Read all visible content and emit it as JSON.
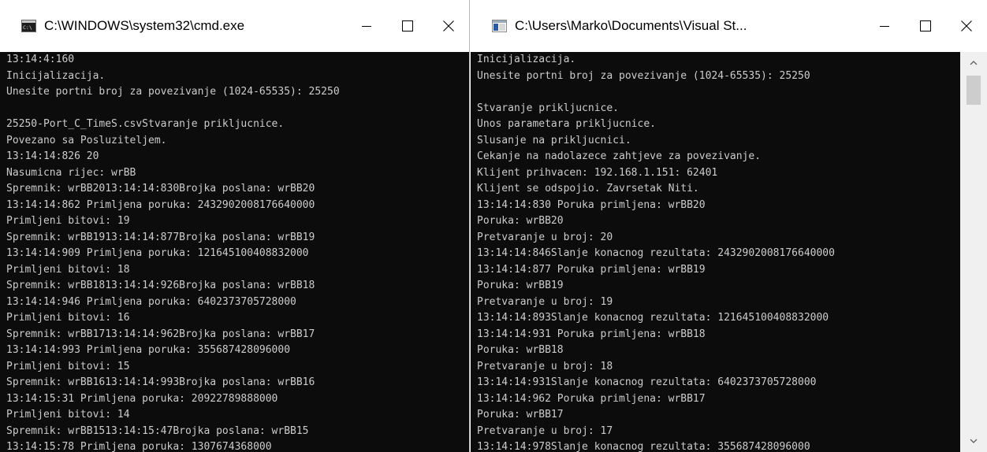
{
  "windows": [
    {
      "id": "left",
      "title": "C:\\WINDOWS\\system32\\cmd.exe",
      "lines": [
        "13:14:4:160",
        "Inicijalizacija.",
        "Unesite portni broj za povezivanje (1024-65535): 25250",
        "",
        "25250-Port_C_TimeS.csvStvaranje prikljucnice.",
        "Povezano sa Posluziteljem.",
        "13:14:14:826 20",
        "Nasumicna rijec: wrBB",
        "Spremnik: wrBB2013:14:14:830Brojka poslana: wrBB20",
        "13:14:14:862 Primljena poruka: 2432902008176640000",
        "Primljeni bitovi: 19",
        "Spremnik: wrBB1913:14:14:877Brojka poslana: wrBB19",
        "13:14:14:909 Primljena poruka: 121645100408832000",
        "Primljeni bitovi: 18",
        "Spremnik: wrBB1813:14:14:926Brojka poslana: wrBB18",
        "13:14:14:946 Primljena poruka: 6402373705728000",
        "Primljeni bitovi: 16",
        "Spremnik: wrBB1713:14:14:962Brojka poslana: wrBB17",
        "13:14:14:993 Primljena poruka: 355687428096000",
        "Primljeni bitovi: 15",
        "Spremnik: wrBB1613:14:14:993Brojka poslana: wrBB16",
        "13:14:15:31 Primljena poruka: 20922789888000",
        "Primljeni bitovi: 14",
        "Spremnik: wrBB1513:14:15:47Brojka poslana: wrBB15",
        "13:14:15:78 Primljena poruka: 1307674368000"
      ]
    },
    {
      "id": "right",
      "title": "C:\\Users\\Marko\\Documents\\Visual St...",
      "lines": [
        "Inicijalizacija.",
        "Unesite portni broj za povezivanje (1024-65535): 25250",
        "",
        "Stvaranje prikljucnice.",
        "Unos parametara prikljucnice.",
        "Slusanje na prikljucnici.",
        "Cekanje na nadolazece zahtjeve za povezivanje.",
        "Klijent prihvacen: 192.168.1.151: 62401",
        "Klijent se odspojio. Zavrsetak Niti.",
        "13:14:14:830 Poruka primljena: wrBB20",
        "Poruka: wrBB20",
        "Pretvaranje u broj: 20",
        "13:14:14:846Slanje konacnog rezultata: 2432902008176640000",
        "13:14:14:877 Poruka primljena: wrBB19",
        "Poruka: wrBB19",
        "Pretvaranje u broj: 19",
        "13:14:14:893Slanje konacnog rezultata: 121645100408832000",
        "13:14:14:931 Poruka primljena: wrBB18",
        "Poruka: wrBB18",
        "Pretvaranje u broj: 18",
        "13:14:14:931Slanje konacnog rezultata: 6402373705728000",
        "13:14:14:962 Poruka primljena: wrBB17",
        "Poruka: wrBB17",
        "Pretvaranje u broj: 17",
        "13:14:14:978Slanje konacnog rezultata: 355687428096000"
      ]
    }
  ],
  "icons": {
    "left_app": "cmd-icon",
    "right_app": "console-app-icon",
    "minimize": "minimize-icon",
    "maximize": "maximize-icon",
    "close": "close-icon",
    "scroll_up": "chevron-up-icon",
    "scroll_down": "chevron-down-icon"
  },
  "colors": {
    "console_bg": "#0c0c0c",
    "console_text": "#cccccc",
    "titlebar_bg": "#ffffff",
    "scrollbar_track": "#f0f0f0",
    "scrollbar_thumb": "#cdcdcd"
  }
}
